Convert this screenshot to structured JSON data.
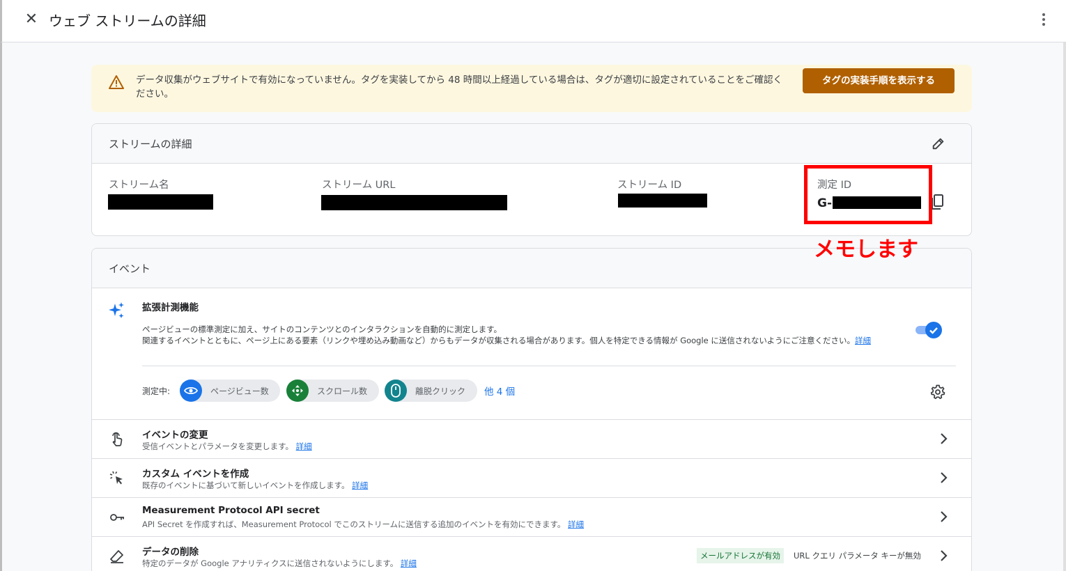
{
  "header": {
    "title": "ウェブ ストリームの詳細"
  },
  "alert": {
    "message": "データ収集がウェブサイトで有効になっていません。タグを実装してから 48 時間以上経過している場合は、タグが適切に設定されていることをご確認ください。",
    "button_label": "タグの実装手順を表示する"
  },
  "stream_details": {
    "heading": "ストリームの詳細",
    "fields": {
      "stream_name": "ストリーム名",
      "stream_url": "ストリーム URL",
      "stream_id": "ストリーム ID",
      "measurement_id": "測定 ID"
    },
    "measurement_id_prefix": "G-"
  },
  "annotation": {
    "text": "メモします"
  },
  "events": {
    "heading": "イベント",
    "enhanced": {
      "title": "拡張計測機能",
      "desc_line1": "ページビューの標準測定に加え、サイトのコンテンツとのインタラクションを自動的に測定します。",
      "desc_line2": "関連するイベントとともに、ページ上にある要素（リンクや埋め込み動画など）からもデータが収集される場合があります。個人を特定できる情報が Google に送信されないようにご注意ください。",
      "learn_more": "詳細",
      "enabled": true,
      "measuring_label": "測定中:",
      "chips": [
        {
          "label": "ページビュー数",
          "icon": "eye-icon",
          "color": "#1a73e8"
        },
        {
          "label": "スクロール数",
          "icon": "scroll-icon",
          "color": "#188038"
        },
        {
          "label": "離脱クリック",
          "icon": "mouse-icon",
          "color": "#12848e"
        }
      ],
      "more": "他 4 個"
    },
    "rows": [
      {
        "title": "イベントの変更",
        "desc": "受信イベントとパラメータを変更します。",
        "link": "詳細",
        "icon": "touch-icon"
      },
      {
        "title": "カスタム イベントを作成",
        "desc": "既存のイベントに基づいて新しいイベントを作成します。",
        "link": "詳細",
        "icon": "click-icon"
      },
      {
        "title": "Measurement Protocol API secret",
        "desc": "API Secret を作成すれば、Measurement Protocol でこのストリームに送信する追加のイベントを有効にできます。",
        "link": "詳細",
        "icon": "key-icon"
      },
      {
        "title": "データの削除",
        "desc": "特定のデータが Google アナリティクスに送信されないようにします。",
        "link": "詳細",
        "icon": "eraser-icon",
        "badge_on": "メールアドレスが有効",
        "badge_off": "URL クエリ パラメータ キーが無効"
      }
    ]
  },
  "colors": {
    "accent": "#1a73e8",
    "alert_bg": "#fef7e0",
    "alert_button": "#b06000",
    "annotation": "#ff0000"
  }
}
